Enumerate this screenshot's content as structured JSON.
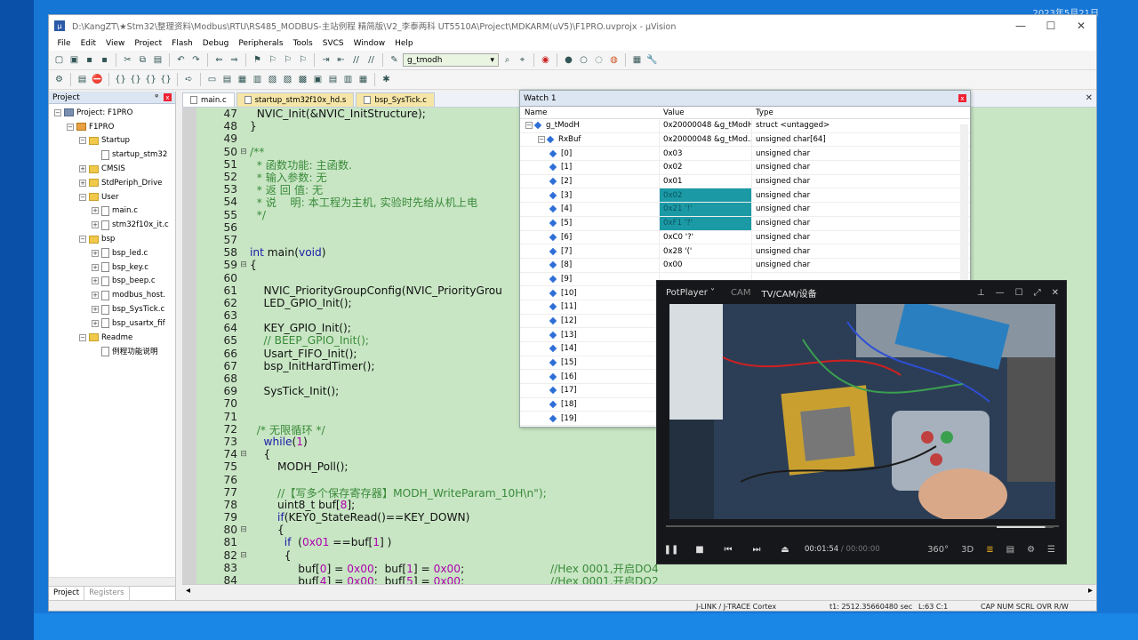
{
  "desktop": {
    "date": "2023年5月21日"
  },
  "window": {
    "title": "D:\\KangZT\\★Stm32\\整理资料\\Modbus\\RTU\\RS485_MODBUS-主站例程 精简版\\V2_李泰两科 UT5510A\\Project\\MDKARM(uV5)\\F1PRO.uvprojx - µVision",
    "min": "—",
    "max": "☐",
    "close": "✕"
  },
  "menu": [
    "File",
    "Edit",
    "View",
    "Project",
    "Flash",
    "Debug",
    "Peripherals",
    "Tools",
    "SVCS",
    "Window",
    "Help"
  ],
  "toolbar": {
    "combo_value": "g_tmodh"
  },
  "project_panel": {
    "title": "Project",
    "pin": "ᵠ",
    "close": "x",
    "tree": [
      {
        "label": "Project: F1PRO",
        "level": 0,
        "icon": "root",
        "exp": "−"
      },
      {
        "label": "F1PRO",
        "level": 1,
        "icon": "target",
        "exp": "−"
      },
      {
        "label": "Startup",
        "level": 2,
        "icon": "folder",
        "exp": "−"
      },
      {
        "label": "startup_stm32",
        "level": 3,
        "icon": "file",
        "exp": ""
      },
      {
        "label": "CMSIS",
        "level": 2,
        "icon": "folder",
        "exp": "+"
      },
      {
        "label": "StdPeriph_Drive",
        "level": 2,
        "icon": "folder",
        "exp": "+"
      },
      {
        "label": "User",
        "level": 2,
        "icon": "folder",
        "exp": "−"
      },
      {
        "label": "main.c",
        "level": 3,
        "icon": "file",
        "exp": "+"
      },
      {
        "label": "stm32f10x_it.c",
        "level": 3,
        "icon": "file",
        "exp": "+"
      },
      {
        "label": "bsp",
        "level": 2,
        "icon": "folder",
        "exp": "−"
      },
      {
        "label": "bsp_led.c",
        "level": 3,
        "icon": "file",
        "exp": "+"
      },
      {
        "label": "bsp_key.c",
        "level": 3,
        "icon": "file",
        "exp": "+"
      },
      {
        "label": "bsp_beep.c",
        "level": 3,
        "icon": "file",
        "exp": "+"
      },
      {
        "label": "modbus_host.",
        "level": 3,
        "icon": "file",
        "exp": "+"
      },
      {
        "label": "bsp_SysTick.c",
        "level": 3,
        "icon": "file",
        "exp": "+"
      },
      {
        "label": "bsp_usartx_fif",
        "level": 3,
        "icon": "file",
        "exp": "+"
      },
      {
        "label": "Readme",
        "level": 2,
        "icon": "folder",
        "exp": "−"
      },
      {
        "label": "例程功能说明",
        "level": 3,
        "icon": "file",
        "exp": ""
      }
    ],
    "tabs": {
      "project": "Project",
      "registers": "Registers"
    }
  },
  "editor": {
    "tabs": [
      "main.c",
      "startup_stm32f10x_hd.s",
      "bsp_SysTick.c"
    ],
    "close": "✕",
    "lines": [
      {
        "n": "47",
        "f": "",
        "t": [
          {
            "s": "  NVIC_Init(&NVIC_InitStructure);"
          }
        ]
      },
      {
        "n": "48",
        "f": "",
        "t": [
          {
            "s": "}"
          }
        ]
      },
      {
        "n": "49",
        "f": "",
        "t": [
          {
            "s": ""
          }
        ]
      },
      {
        "n": "50",
        "f": "⊟",
        "t": [
          {
            "s": "/**",
            "c": "cm"
          }
        ]
      },
      {
        "n": "51",
        "f": "",
        "t": [
          {
            "s": "  * 函数功能: 主函数.",
            "c": "cm"
          }
        ]
      },
      {
        "n": "52",
        "f": "",
        "t": [
          {
            "s": "  * 输入参数: 无",
            "c": "cm"
          }
        ]
      },
      {
        "n": "53",
        "f": "",
        "t": [
          {
            "s": "  * 返 回 值: 无",
            "c": "cm"
          }
        ]
      },
      {
        "n": "54",
        "f": "",
        "t": [
          {
            "s": "  * 说    明: 本工程为主机, 实验时先给从机上电",
            "c": "cm"
          }
        ]
      },
      {
        "n": "55",
        "f": "",
        "t": [
          {
            "s": "  */",
            "c": "cm"
          }
        ]
      },
      {
        "n": "56",
        "f": "",
        "t": [
          {
            "s": ""
          }
        ]
      },
      {
        "n": "57",
        "f": "",
        "t": [
          {
            "s": ""
          }
        ]
      },
      {
        "n": "58",
        "f": "",
        "t": [
          {
            "s": "int",
            "c": "kw"
          },
          {
            "s": " main("
          },
          {
            "s": "void",
            "c": "kw"
          },
          {
            "s": ")"
          }
        ]
      },
      {
        "n": "59",
        "f": "⊟",
        "t": [
          {
            "s": "{"
          }
        ]
      },
      {
        "n": "60",
        "f": "",
        "t": [
          {
            "s": ""
          }
        ]
      },
      {
        "n": "61",
        "f": "",
        "t": [
          {
            "s": "    NVIC_PriorityGroupConfig(NVIC_PriorityGrou"
          }
        ]
      },
      {
        "n": "62",
        "f": "",
        "t": [
          {
            "s": "    LED_GPIO_Init();"
          }
        ]
      },
      {
        "n": "63",
        "f": "",
        "t": [
          {
            "s": ""
          }
        ]
      },
      {
        "n": "64",
        "f": "",
        "t": [
          {
            "s": "    KEY_GPIO_Init();"
          }
        ]
      },
      {
        "n": "65",
        "f": "",
        "t": [
          {
            "s": "    // BEEP_GPIO_Init();",
            "c": "cm"
          }
        ]
      },
      {
        "n": "66",
        "f": "",
        "t": [
          {
            "s": "    Usart_FIFO_Init();"
          }
        ]
      },
      {
        "n": "67",
        "f": "",
        "t": [
          {
            "s": "    bsp_InitHardTimer();"
          }
        ]
      },
      {
        "n": "68",
        "f": "",
        "t": [
          {
            "s": ""
          }
        ]
      },
      {
        "n": "69",
        "f": "",
        "t": [
          {
            "s": "    SysTick_Init();"
          }
        ]
      },
      {
        "n": "70",
        "f": "",
        "t": [
          {
            "s": ""
          }
        ]
      },
      {
        "n": "71",
        "f": "",
        "t": [
          {
            "s": ""
          }
        ]
      },
      {
        "n": "72",
        "f": "",
        "t": [
          {
            "s": "  /* 无限循环 */",
            "c": "cm"
          }
        ]
      },
      {
        "n": "73",
        "f": "",
        "t": [
          {
            "s": "    "
          },
          {
            "s": "while",
            "c": "kw"
          },
          {
            "s": "("
          },
          {
            "s": "1",
            "c": "nm"
          },
          {
            "s": ")"
          }
        ]
      },
      {
        "n": "74",
        "f": "⊟",
        "t": [
          {
            "s": "    {"
          }
        ]
      },
      {
        "n": "75",
        "f": "",
        "t": [
          {
            "s": "        MODH_Poll();"
          }
        ]
      },
      {
        "n": "76",
        "f": "",
        "t": [
          {
            "s": ""
          }
        ]
      },
      {
        "n": "77",
        "f": "",
        "t": [
          {
            "s": "        //【写多个保存寄存器】MODH_WriteParam_10H\\n\");",
            "c": "cm"
          }
        ]
      },
      {
        "n": "78",
        "f": "",
        "t": [
          {
            "s": "        uint8_t buf["
          },
          {
            "s": "8",
            "c": "nm"
          },
          {
            "s": "];"
          }
        ]
      },
      {
        "n": "79",
        "f": "",
        "t": [
          {
            "s": "        "
          },
          {
            "s": "if",
            "c": "kw"
          },
          {
            "s": "(KEY0_StateRead()==KEY_DOWN)"
          }
        ]
      },
      {
        "n": "80",
        "f": "⊟",
        "t": [
          {
            "s": "        {"
          }
        ]
      },
      {
        "n": "81",
        "f": "",
        "t": [
          {
            "s": "          "
          },
          {
            "s": "if",
            "c": "kw"
          },
          {
            "s": "  ("
          },
          {
            "s": "0x01",
            "c": "nm"
          },
          {
            "s": " ==buf["
          },
          {
            "s": "1",
            "c": "nm"
          },
          {
            "s": "] )"
          }
        ]
      },
      {
        "n": "82",
        "f": "⊟",
        "t": [
          {
            "s": "          {"
          }
        ]
      },
      {
        "n": "83",
        "f": "",
        "t": [
          {
            "s": "              buf["
          },
          {
            "s": "0",
            "c": "nm"
          },
          {
            "s": "] = "
          },
          {
            "s": "0x00",
            "c": "nm"
          },
          {
            "s": ";  buf["
          },
          {
            "s": "1",
            "c": "nm"
          },
          {
            "s": "] = "
          },
          {
            "s": "0x00",
            "c": "nm"
          },
          {
            "s": ";                         "
          },
          {
            "s": "//Hex 0001,开启DO4",
            "c": "cm"
          }
        ]
      },
      {
        "n": "84",
        "f": "",
        "t": [
          {
            "s": "              buf["
          },
          {
            "s": "4",
            "c": "nm"
          },
          {
            "s": "] = "
          },
          {
            "s": "0x00",
            "c": "nm"
          },
          {
            "s": ";  buf["
          },
          {
            "s": "5",
            "c": "nm"
          },
          {
            "s": "] = "
          },
          {
            "s": "0x00",
            "c": "nm"
          },
          {
            "s": ";                         "
          },
          {
            "s": "//Hex 0001,开启DO2",
            "c": "cm"
          }
        ]
      }
    ]
  },
  "watch": {
    "title": "Watch 1",
    "close": "x",
    "cols": {
      "name": "Name",
      "value": "Value",
      "type": "Type"
    },
    "rows": [
      {
        "name": "g_tModH",
        "value": "0x20000048 &g_tModH",
        "type": "struct <untagged>",
        "indent": 0,
        "exp": "−",
        "hl": false
      },
      {
        "name": "RxBuf",
        "value": "0x20000048 &g_tMod...",
        "type": "unsigned char[64]",
        "indent": 1,
        "exp": "−",
        "hl": false
      },
      {
        "name": "[0]",
        "value": "0x03",
        "type": "unsigned char",
        "indent": 2,
        "exp": "",
        "hl": false
      },
      {
        "name": "[1]",
        "value": "0x02",
        "type": "unsigned char",
        "indent": 2,
        "exp": "",
        "hl": false
      },
      {
        "name": "[2]",
        "value": "0x01",
        "type": "unsigned char",
        "indent": 2,
        "exp": "",
        "hl": false
      },
      {
        "name": "[3]",
        "value": "0x02",
        "type": "unsigned char",
        "indent": 2,
        "exp": "",
        "hl": true
      },
      {
        "name": "[4]",
        "value": "0x21 '!'",
        "type": "unsigned char",
        "indent": 2,
        "exp": "",
        "hl": true
      },
      {
        "name": "[5]",
        "value": "0xF1 '?'",
        "type": "unsigned char",
        "indent": 2,
        "exp": "",
        "hl": true
      },
      {
        "name": "[6]",
        "value": "0xC0 '?'",
        "type": "unsigned char",
        "indent": 2,
        "exp": "",
        "hl": false
      },
      {
        "name": "[7]",
        "value": "0x28 '('",
        "type": "unsigned char",
        "indent": 2,
        "exp": "",
        "hl": false
      },
      {
        "name": "[8]",
        "value": "0x00",
        "type": "unsigned char",
        "indent": 2,
        "exp": "",
        "hl": false
      },
      {
        "name": "[9]",
        "value": "",
        "type": "",
        "indent": 2,
        "exp": "",
        "hl": false
      },
      {
        "name": "[10]",
        "value": "",
        "type": "",
        "indent": 2,
        "exp": "",
        "hl": false
      },
      {
        "name": "[11]",
        "value": "",
        "type": "",
        "indent": 2,
        "exp": "",
        "hl": false
      },
      {
        "name": "[12]",
        "value": "",
        "type": "",
        "indent": 2,
        "exp": "",
        "hl": false
      },
      {
        "name": "[13]",
        "value": "",
        "type": "",
        "indent": 2,
        "exp": "",
        "hl": false
      },
      {
        "name": "[14]",
        "value": "",
        "type": "",
        "indent": 2,
        "exp": "",
        "hl": false
      },
      {
        "name": "[15]",
        "value": "",
        "type": "",
        "indent": 2,
        "exp": "",
        "hl": false
      },
      {
        "name": "[16]",
        "value": "",
        "type": "",
        "indent": 2,
        "exp": "",
        "hl": false
      },
      {
        "name": "[17]",
        "value": "",
        "type": "",
        "indent": 2,
        "exp": "",
        "hl": false
      },
      {
        "name": "[18]",
        "value": "",
        "type": "",
        "indent": 2,
        "exp": "",
        "hl": false
      },
      {
        "name": "[19]",
        "value": "",
        "type": "",
        "indent": 2,
        "exp": "",
        "hl": false
      }
    ]
  },
  "player": {
    "brand": "PotPlayer ˅",
    "tab_cam": "CAM",
    "tab_device": "TV/CAM/设备",
    "time_current": "00:01:54",
    "time_total": "/ 00:00:00",
    "progress": 0.0,
    "volume": 0.85
  },
  "status": {
    "debugger": "J-LINK / J-TRACE Cortex",
    "time": "t1: 2512.35660480 sec",
    "position": "L:63 C:1",
    "flags": "CAP  NUM  SCRL  OVR  R/W"
  }
}
